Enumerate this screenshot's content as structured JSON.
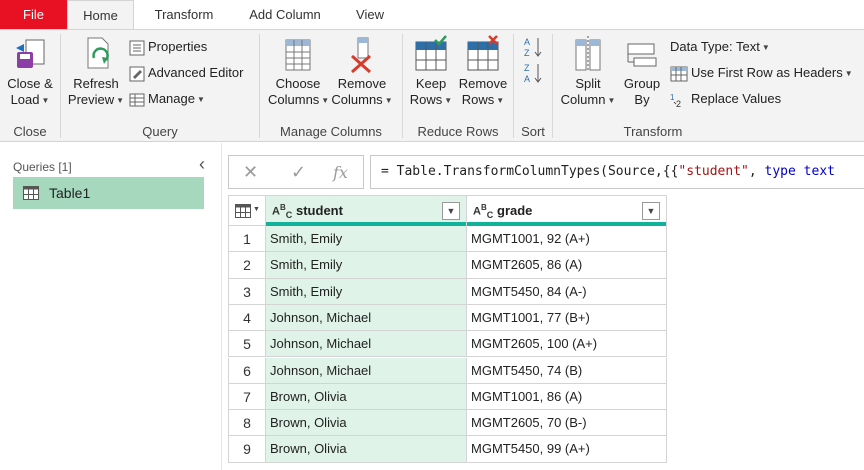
{
  "tabs": [
    {
      "label": "File"
    },
    {
      "label": "Home"
    },
    {
      "label": "Transform"
    },
    {
      "label": "Add Column"
    },
    {
      "label": "View"
    }
  ],
  "ribbon": {
    "close_group": {
      "label": "Close",
      "close_load_l1": "Close &",
      "close_load_l2": "Load"
    },
    "query_group": {
      "label": "Query",
      "refresh_l1": "Refresh",
      "refresh_l2": "Preview",
      "properties": "Properties",
      "advanced_editor": "Advanced Editor",
      "manage": "Manage"
    },
    "manage_columns_group": {
      "label": "Manage Columns",
      "choose_l1": "Choose",
      "choose_l2": "Columns",
      "remove_l1": "Remove",
      "remove_l2": "Columns"
    },
    "reduce_rows_group": {
      "label": "Reduce Rows",
      "keep_l1": "Keep",
      "keep_l2": "Rows",
      "remove_l1": "Remove",
      "remove_l2": "Rows"
    },
    "sort_group": {
      "label": "Sort"
    },
    "transform_group": {
      "label": "Transform",
      "split_l1": "Split",
      "split_l2": "Column",
      "group_l1": "Group",
      "group_l2": "By",
      "data_type": "Data Type: Text",
      "use_first_row": "Use First Row as Headers",
      "replace_values": "Replace Values"
    }
  },
  "queries": {
    "header": "Queries [1]",
    "items": [
      {
        "name": "Table1"
      }
    ]
  },
  "formula": {
    "prefix": "= Table.TransformColumnTypes(Source,{{",
    "string1": "\"student\"",
    "sep": ", ",
    "keyword": "type",
    "suffix": " text"
  },
  "table": {
    "columns": [
      {
        "name": "student",
        "type_icon": "ABC"
      },
      {
        "name": "grade",
        "type_icon": "ABC"
      }
    ],
    "rows": [
      {
        "n": "1",
        "student": "Smith, Emily",
        "grade": "MGMT1001, 92 (A+)"
      },
      {
        "n": "2",
        "student": "Smith, Emily",
        "grade": "MGMT2605, 86 (A)"
      },
      {
        "n": "3",
        "student": "Smith, Emily",
        "grade": "MGMT5450, 84 (A-)"
      },
      {
        "n": "4",
        "student": "Johnson, Michael",
        "grade": "MGMT1001, 77 (B+)"
      },
      {
        "n": "5",
        "student": "Johnson, Michael",
        "grade": "MGMT2605, 100 (A+)"
      },
      {
        "n": "6",
        "student": "Johnson, Michael",
        "grade": "MGMT5450, 74 (B)"
      },
      {
        "n": "7",
        "student": "Brown, Olivia",
        "grade": "MGMT1001, 86 (A)"
      },
      {
        "n": "8",
        "student": "Brown, Olivia",
        "grade": "MGMT2605, 70 (B-)"
      },
      {
        "n": "9",
        "student": "Brown, Olivia",
        "grade": "MGMT5450, 99 (A+)"
      }
    ]
  },
  "colors": {
    "file_tab": "#e81123",
    "selected_column": "#dff3e8",
    "column_bar": "#10b39a",
    "query_selected": "#a6d8be"
  }
}
